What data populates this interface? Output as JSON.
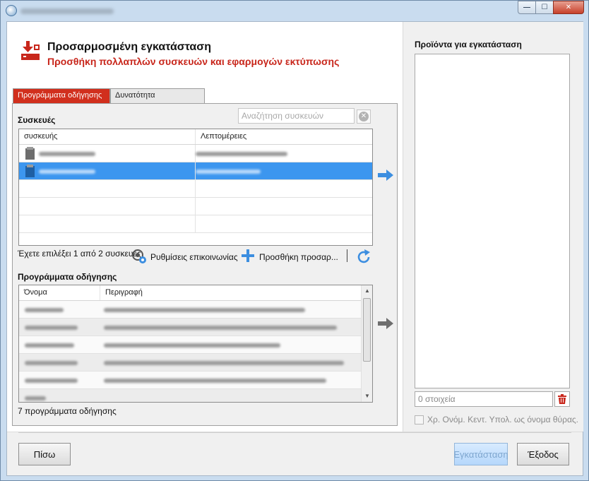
{
  "window": {
    "controls": {
      "minimize": "—",
      "maximize": "☐",
      "close": "✕"
    }
  },
  "header": {
    "title": "Προσαρμοσμένη εγκατάσταση",
    "subtitle": "Προσθήκη πολλαπλών συσκευών και εφαρμογών εκτύπωσης",
    "icon": "download-to-printer-icon",
    "accent_color": "#c8261b"
  },
  "tabs": [
    {
      "label": "Προγράμματα οδήγησης",
      "active": true
    },
    {
      "label": "Δυνατότητα",
      "active": false
    }
  ],
  "devices": {
    "section_label": "Συσκευές",
    "search_placeholder": "Αναζήτηση συσκευών",
    "columns": [
      "συσκευής",
      "Λεπτομέρειες"
    ],
    "rows": [
      {
        "selected": false
      },
      {
        "selected": true
      }
    ],
    "selection_status": "Έχετε επιλέξει 1 από 2 συσκευές",
    "comm_settings_label": "Ρυθμίσεις επικοινωνίας",
    "add_custom_label": "Προσθήκη προσαρ...",
    "selected_color": "#3c96ef"
  },
  "drivers": {
    "section_label": "Προγράμματα οδήγησης",
    "columns": [
      "Όνομα",
      "Περιγραφή"
    ],
    "count_label": "7 προγράμματα οδήγησης"
  },
  "products": {
    "title": "Προϊόντα για εγκατάσταση",
    "count_placeholder": "0 στοιχεία",
    "checkbox_label": "Χρ. Ονόμ. Κεντ. Υπολ. ως όνομα θύρας."
  },
  "footer": {
    "back_label": "Πίσω",
    "install_label": "Εγκατάσταση",
    "exit_label": "Έξοδος"
  }
}
